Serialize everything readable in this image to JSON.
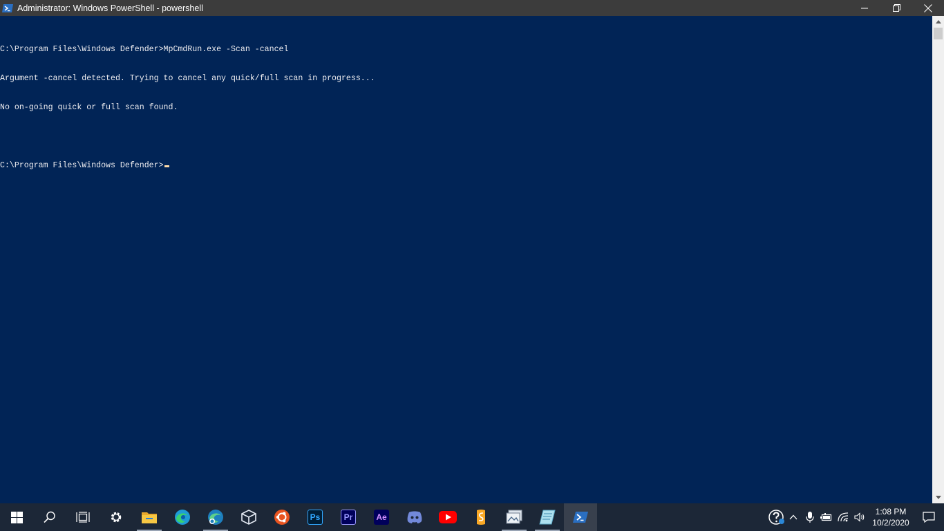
{
  "window": {
    "title": "Administrator: Windows PowerShell - powershell",
    "controls": {
      "minimize": "minimize",
      "restore": "restore",
      "close": "close"
    }
  },
  "console": {
    "lines": [
      "C:\\Program Files\\Windows Defender>MpCmdRun.exe -Scan -cancel",
      "Argument -cancel detected. Trying to cancel any quick/full scan in progress...",
      "No on-going quick or full scan found.",
      "",
      "C:\\Program Files\\Windows Defender>"
    ],
    "colors": {
      "background": "#012456",
      "foreground": "#eeedf0",
      "cursor": "#fedba9"
    }
  },
  "taskbar": {
    "apps": [
      {
        "name": "start",
        "icon": "windows-logo-icon"
      },
      {
        "name": "search",
        "icon": "search-icon"
      },
      {
        "name": "task-view",
        "icon": "task-view-icon"
      },
      {
        "name": "settings",
        "icon": "gear-icon"
      },
      {
        "name": "file-explorer",
        "icon": "folder-icon"
      },
      {
        "name": "edge",
        "icon": "edge-icon"
      },
      {
        "name": "edge-beta",
        "icon": "edge-beta-icon"
      },
      {
        "name": "virtualbox",
        "icon": "cube-icon"
      },
      {
        "name": "ubuntu",
        "icon": "ubuntu-icon"
      },
      {
        "name": "photoshop",
        "icon": "photoshop-icon",
        "label": "Ps"
      },
      {
        "name": "premiere",
        "icon": "premiere-icon",
        "label": "Pr"
      },
      {
        "name": "after-effects",
        "icon": "after-effects-icon",
        "label": "Ae"
      },
      {
        "name": "discord",
        "icon": "discord-icon"
      },
      {
        "name": "youtube",
        "icon": "youtube-icon"
      },
      {
        "name": "sublime",
        "icon": "sublime-icon"
      },
      {
        "name": "photos",
        "icon": "photos-icon"
      },
      {
        "name": "notes",
        "icon": "notes-icon"
      },
      {
        "name": "powershell",
        "icon": "powershell-icon"
      }
    ],
    "clock": {
      "time": "1:08 PM",
      "date": "10/2/2020"
    }
  }
}
